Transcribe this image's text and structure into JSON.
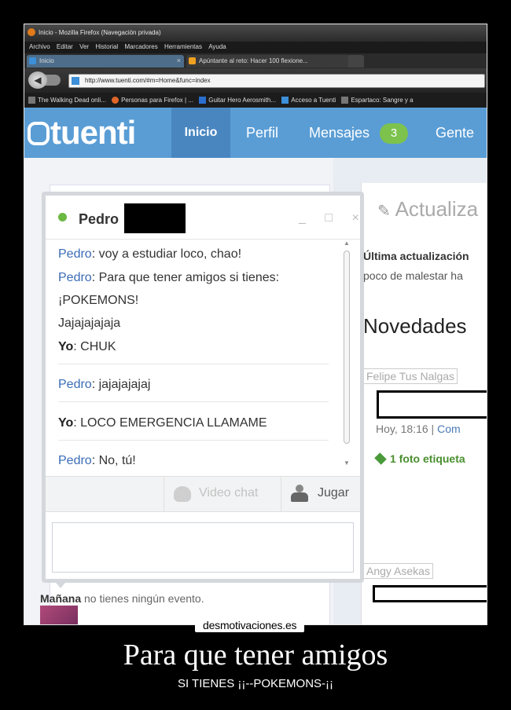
{
  "browser": {
    "window_title": "Inicio - Mozilla Firefox (Navegación privada)",
    "menu": [
      "Archivo",
      "Editar",
      "Ver",
      "Historial",
      "Marcadores",
      "Herramientas",
      "Ayuda"
    ],
    "tabs": [
      {
        "label": "Inicio"
      },
      {
        "label": "Apúntante al reto: Hacer 100 flexione..."
      }
    ],
    "url": "http://www.tuenti.com/#m=Home&func=index",
    "bookmarks": [
      "The Walking Dead onli...",
      "Personas para Firefox | ...",
      "Guitar Hero Aerosmith...",
      "Acceso a Tuenti",
      "Espartaco: Sangre y a"
    ]
  },
  "tuenti": {
    "logo": "tuenti",
    "nav": {
      "inicio": "Inicio",
      "perfil": "Perfil",
      "mensajes": "Mensajes",
      "mensajes_count": "3",
      "gente": "Gente"
    },
    "right": {
      "actualiza": "Actualiza",
      "ultima": "Última actualización",
      "poco": "poco de malestar ha",
      "novedades": "Novedades",
      "feli": "Felipe Tus Nalgas",
      "hoy": "Hoy, 18:16",
      "com": "Com",
      "foto": "1 foto etiqueta",
      "angy": "Angy Asekas"
    },
    "events": {
      "manana_bold": "Mañana",
      "manana_rest": "no tienes ningún evento."
    }
  },
  "chat": {
    "contact_name": "Pedro",
    "window_controls": "_ □ ×",
    "messages": [
      {
        "from": "Pedro",
        "text": "voy a estudiar loco, chao!"
      },
      {
        "from": "Pedro",
        "text": "Para que tener amigos si tienes: ¡POKEMONS!"
      },
      {
        "from": "",
        "text": "Jajajajajaja"
      },
      {
        "from": "Yo",
        "text": "CHUK"
      },
      {
        "from": "Pedro",
        "text": "jajajajajaj"
      },
      {
        "from": "Yo",
        "text": "LOCO EMERGENCIA LLAMAME"
      },
      {
        "from": "Pedro",
        "text": "No, tú!"
      }
    ],
    "video_chat": "Video chat",
    "jugar": "Jugar",
    "input_value": ""
  },
  "watermark": "desmotivaciones.es",
  "caption": {
    "title": "Para que tener amigos",
    "subtitle": "SI TIENES ¡¡--POKEMONS-¡¡"
  }
}
